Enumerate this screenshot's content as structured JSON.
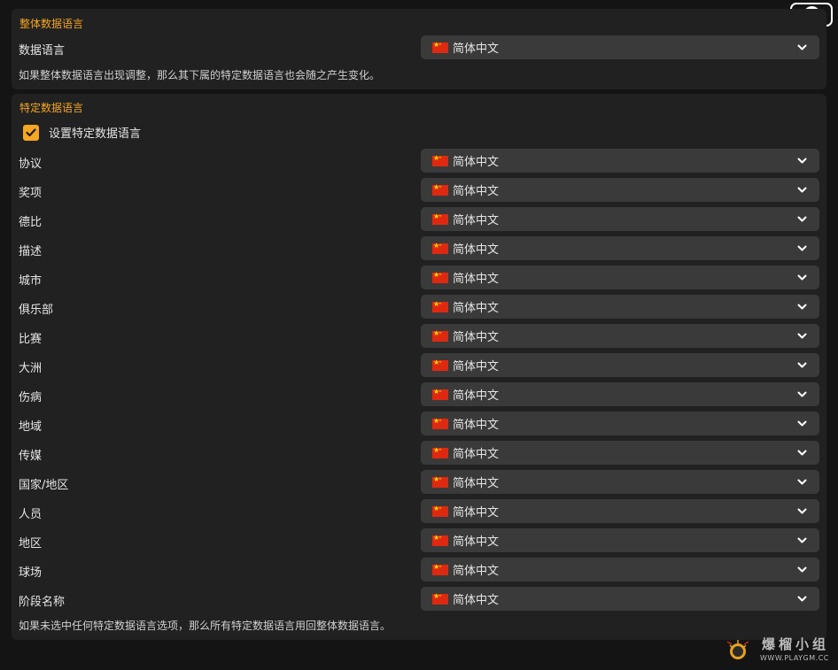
{
  "global": {
    "section_title": "整体数据语言",
    "label": "数据语言",
    "value": "简体中文",
    "flag_icon": "china-flag-icon",
    "note": "如果整体数据语言出现调整，那么其下属的特定数据语言也会随之产生变化。"
  },
  "specific": {
    "section_title": "特定数据语言",
    "checkbox_label": "设置特定数据语言",
    "checkbox_checked": true,
    "rows": [
      {
        "label": "协议",
        "value": "简体中文"
      },
      {
        "label": "奖项",
        "value": "简体中文"
      },
      {
        "label": "德比",
        "value": "简体中文"
      },
      {
        "label": "描述",
        "value": "简体中文"
      },
      {
        "label": "城市",
        "value": "简体中文"
      },
      {
        "label": "俱乐部",
        "value": "简体中文"
      },
      {
        "label": "比赛",
        "value": "简体中文"
      },
      {
        "label": "大洲",
        "value": "简体中文"
      },
      {
        "label": "伤病",
        "value": "简体中文"
      },
      {
        "label": "地域",
        "value": "简体中文"
      },
      {
        "label": "传媒",
        "value": "简体中文"
      },
      {
        "label": "国家/地区",
        "value": "简体中文"
      },
      {
        "label": "人员",
        "value": "简体中文"
      },
      {
        "label": "地区",
        "value": "简体中文"
      },
      {
        "label": "球场",
        "value": "简体中文"
      },
      {
        "label": "阶段名称",
        "value": "简体中文"
      }
    ],
    "note": "如果未选中任何特定数据语言选项，那么所有特定数据语言用回整体数据语言。"
  },
  "close_icon": "close-icon",
  "watermark": {
    "title": "爆榴小组",
    "url": "WWW.PLAYGM.CC"
  },
  "colors": {
    "accent": "#f5a623",
    "panel": "#212121",
    "background": "#141414",
    "select": "#3a3a3a"
  }
}
